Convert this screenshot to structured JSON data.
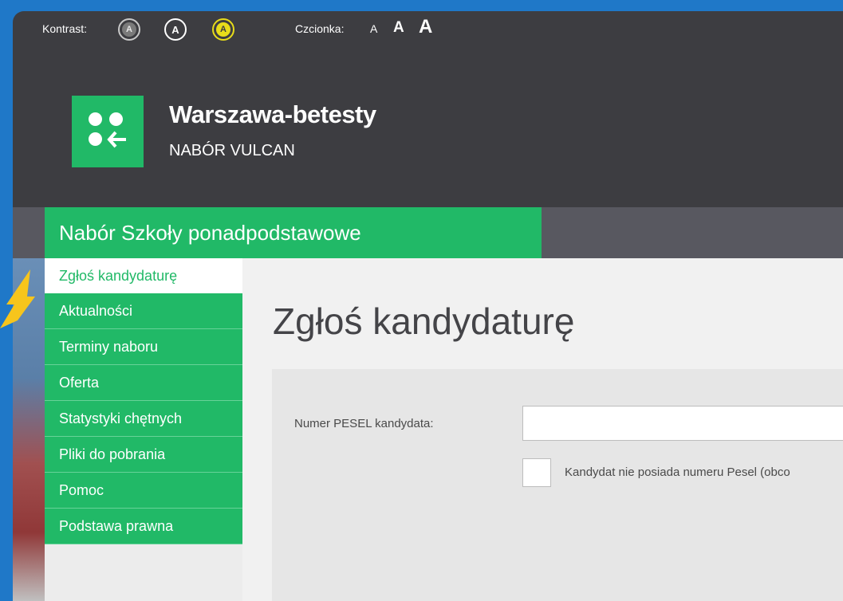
{
  "accessibility": {
    "contrast_label": "Kontrast:",
    "contrast_button_letter": "A",
    "font_label": "Czcionka:",
    "font_small": "A",
    "font_medium": "A",
    "font_large": "A"
  },
  "header": {
    "title": "Warszawa-betesty",
    "subtitle": "NABÓR VULCAN",
    "brand_color": "#21b967"
  },
  "nav": {
    "title": "Nabór Szkoły ponadpodstawowe",
    "items": [
      {
        "label": "Zgłoś kandydaturę",
        "active": true
      },
      {
        "label": "Aktualności"
      },
      {
        "label": "Terminy naboru"
      },
      {
        "label": "Oferta"
      },
      {
        "label": "Statystyki chętnych"
      },
      {
        "label": "Pliki do pobrania"
      },
      {
        "label": "Pomoc"
      },
      {
        "label": "Podstawa prawna"
      }
    ]
  },
  "main": {
    "page_title": "Zgłoś kandydaturę",
    "pesel_label": "Numer PESEL kandydata:",
    "pesel_value": "",
    "no_pesel_label": "Kandydat nie posiada numeru Pesel (obco"
  },
  "icons": {
    "logo": "logo-dots-arrow-icon",
    "decoration": "yellow-arrow-icon"
  }
}
